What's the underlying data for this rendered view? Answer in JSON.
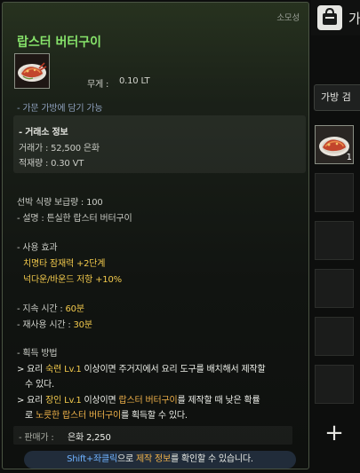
{
  "tooltip": {
    "category": "소모성",
    "title": "랍스터 버터구이",
    "weight_label": "무게 :",
    "weight_value": "0.10 LT",
    "bag_note": "- 가문 가방에 담기 가능",
    "market": {
      "header": "- 거래소 정보",
      "price": "거래가 : 52,500 은화",
      "stock": "적재량 : 0.30 VT"
    },
    "ship_food": "선박 식량 보급량 : 100",
    "description": "- 설명 : 튼실한 랍스터 버터구이",
    "effect_header": "- 사용 효과",
    "effect_1": "치명타 잠재력 +2단계",
    "effect_2": "넉다운/바운드 저항 +10%",
    "duration_label": "- 지속 시간 : ",
    "duration_value": "60분",
    "cooldown_label": "- 재사용 시간 : ",
    "cooldown_value": "30분",
    "obtain_header": "- 획득 방법",
    "obtain_1a_prefix": " > 요리 ",
    "obtain_1a_hl": "숙련 Lv.1",
    "obtain_1a_suffix": " 이상이면 주거지에서 요리 도구를 배치해서 제작할",
    "obtain_1b": "수 있다.",
    "obtain_2a_prefix": " > 요리 ",
    "obtain_2a_hl": "장인 Lv.1",
    "obtain_2a_mid": " 이상이면 ",
    "obtain_2a_hl2": "랍스터 버터구이",
    "obtain_2a_suffix": "를 제작할 때 낮은 확률",
    "obtain_2b_prefix": "로 ",
    "obtain_2b_hl": "노릇한 랍스터 버터구이",
    "obtain_2b_suffix": "를 획득할 수 있다.",
    "sell_label": "- 판매가 :",
    "sell_value": "은화 2,250",
    "hint_key": "Shift+좌클릭",
    "hint_mid": "으로 ",
    "hint_link": "제작 정보",
    "hint_suffix": "를 확인할 수 있습니다."
  },
  "bag": {
    "title_fragment": "가",
    "search_label": "가방 검",
    "slot_1_count": "1",
    "add_glyph": "+"
  },
  "colors": {
    "title_green": "#86e26a",
    "highlight_yellow": "#f2c94c",
    "link_orange": "#f0b24a",
    "key_blue": "#6fb2ff"
  }
}
